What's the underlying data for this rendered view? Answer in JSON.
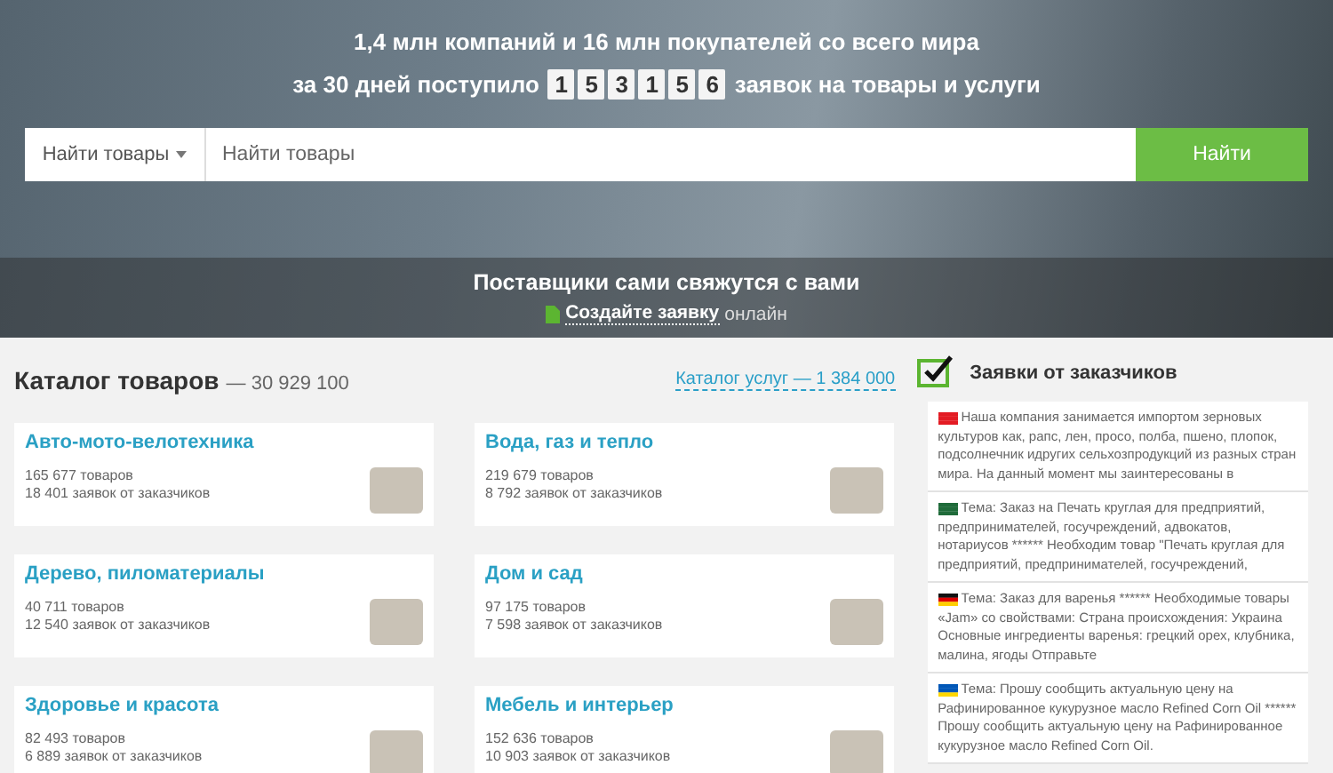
{
  "hero": {
    "headline": "1,4 млн компаний и 16 млн покупателей со всего мира",
    "counter_prefix": "за 30 дней поступило",
    "counter_digits": [
      "1",
      "5",
      "3",
      "1",
      "5",
      "6"
    ],
    "counter_suffix": "заявок на товары и услуги",
    "search": {
      "scope": "Найти товары",
      "placeholder": "Найти товары",
      "button": "Найти"
    },
    "banner": {
      "title": "Поставщики сами свяжутся с вами",
      "link": "Создайте заявку",
      "suffix": "онлайн"
    }
  },
  "catalog": {
    "title": "Каталог товаров",
    "count": "— 30 929 100",
    "services_link": "Каталог услуг — 1 384 000",
    "categories": [
      {
        "name": "Авто-мото-велотехника",
        "goods": "165 677 товаров",
        "requests": "18 401 заявок от заказчиков"
      },
      {
        "name": "Вода, газ и тепло",
        "goods": "219 679 товаров",
        "requests": "8 792 заявок от заказчиков"
      },
      {
        "name": "Дерево, пиломатериалы",
        "goods": "40 711 товаров",
        "requests": "12 540 заявок от заказчиков"
      },
      {
        "name": "Дом и сад",
        "goods": "97 175 товаров",
        "requests": "7 598 заявок от заказчиков"
      },
      {
        "name": "Здоровье и красота",
        "goods": "82 493 товаров",
        "requests": "6 889 заявок от заказчиков"
      },
      {
        "name": "Мебель и интерьер",
        "goods": "152 636 товаров",
        "requests": "10 903 заявок от заказчиков"
      }
    ]
  },
  "requests": {
    "title": "Заявки от заказчиков",
    "items": [
      {
        "kind": "red",
        "text": "Наша компания занимается импортом зерновых культуров как, рапс, лен, просо, полба, пшено, плопок, подсолнечник идругих сельхозпродукций из разных стран мира. На данный момент мы заинтересованы в"
      },
      {
        "kind": "green",
        "text": "Тема: Заказ на Печать круглая для предприятий, предпринимателей, госучреждений, адвокатов, нотариусов ****** Необходим товар \"Печать круглая для предприятий, предпринимателей, госучреждений,"
      },
      {
        "kind": "de",
        "text": "Тема: Заказ для варенья ****** Необходимые товары «Jam» со свойствами: Страна происхождения: Украина Основные ингредиенты варенья: грецкий орех, клубника, малина, ягоды Отправьте"
      },
      {
        "kind": "ua",
        "text": "Тема: Прошу сообщить актуальную цену на Рафинированное кукурузное масло Refined Corn Oil ****** Прошу сообщить актуальную цену на Рафинированное кукурузное масло Refined Corn Oil."
      }
    ]
  }
}
